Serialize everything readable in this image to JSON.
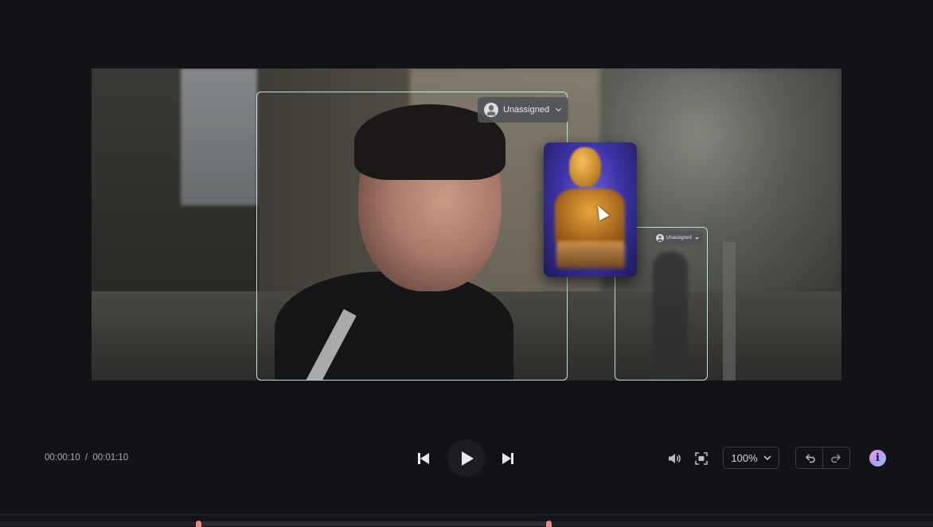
{
  "video": {
    "annotations": [
      {
        "assignee_label": "Unassigned"
      },
      {
        "assignee_label": "Unassigned"
      }
    ]
  },
  "player": {
    "current_time": "00:00:10",
    "separator": "/",
    "total_time": "00:01:10",
    "zoom": "100%",
    "info_glyph": "i"
  },
  "icons": {
    "prev": "skip-previous-icon",
    "play": "play-icon",
    "next": "skip-next-icon",
    "volume": "volume-icon",
    "fit": "fit-screen-icon",
    "undo": "undo-icon",
    "redo": "redo-icon",
    "info": "info-icon"
  },
  "colors": {
    "bbox": "#b9e3df",
    "timeline_handle": "#e88a80"
  }
}
